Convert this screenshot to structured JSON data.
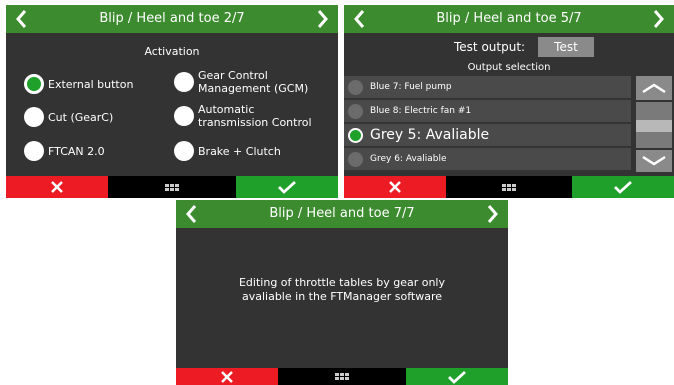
{
  "screen1": {
    "title": "Blip / Heel and toe 2/7",
    "section_title": "Activation",
    "options": [
      {
        "label": "External button",
        "selected": true
      },
      {
        "label": "Gear Control Management (GCM)",
        "selected": false
      },
      {
        "label": "Cut (GearC)",
        "selected": false
      },
      {
        "label": "Automatic transmission Control",
        "selected": false
      },
      {
        "label": "FTCAN 2.0",
        "selected": false
      },
      {
        "label": "Brake + Clutch",
        "selected": false
      }
    ]
  },
  "screen2": {
    "title": "Blip / Heel and toe 5/7",
    "test_output_label": "Test output:",
    "test_button": "Test",
    "output_selection_label": "Output selection",
    "outputs": [
      {
        "label": "Blue 7: Fuel pump",
        "selected": false
      },
      {
        "label": "Blue 8: Electric fan #1",
        "selected": false
      },
      {
        "label": "Grey 5: Avaliable",
        "selected": true
      },
      {
        "label": "Grey 6: Avaliable",
        "selected": false
      }
    ]
  },
  "screen3": {
    "title": "Blip / Heel and toe 7/7",
    "message_line1": "Editing of throttle tables by gear only",
    "message_line2": "avaliable in the FTManager software"
  },
  "footer": {
    "cancel_icon": "close-icon",
    "menu_icon": "grid-menu-icon",
    "confirm_icon": "checkmark-icon"
  },
  "colors": {
    "header_green": "#3d8b2f",
    "cancel_red": "#ed1c24",
    "confirm_green": "#1ea02a",
    "screen_bg": "#333333"
  }
}
